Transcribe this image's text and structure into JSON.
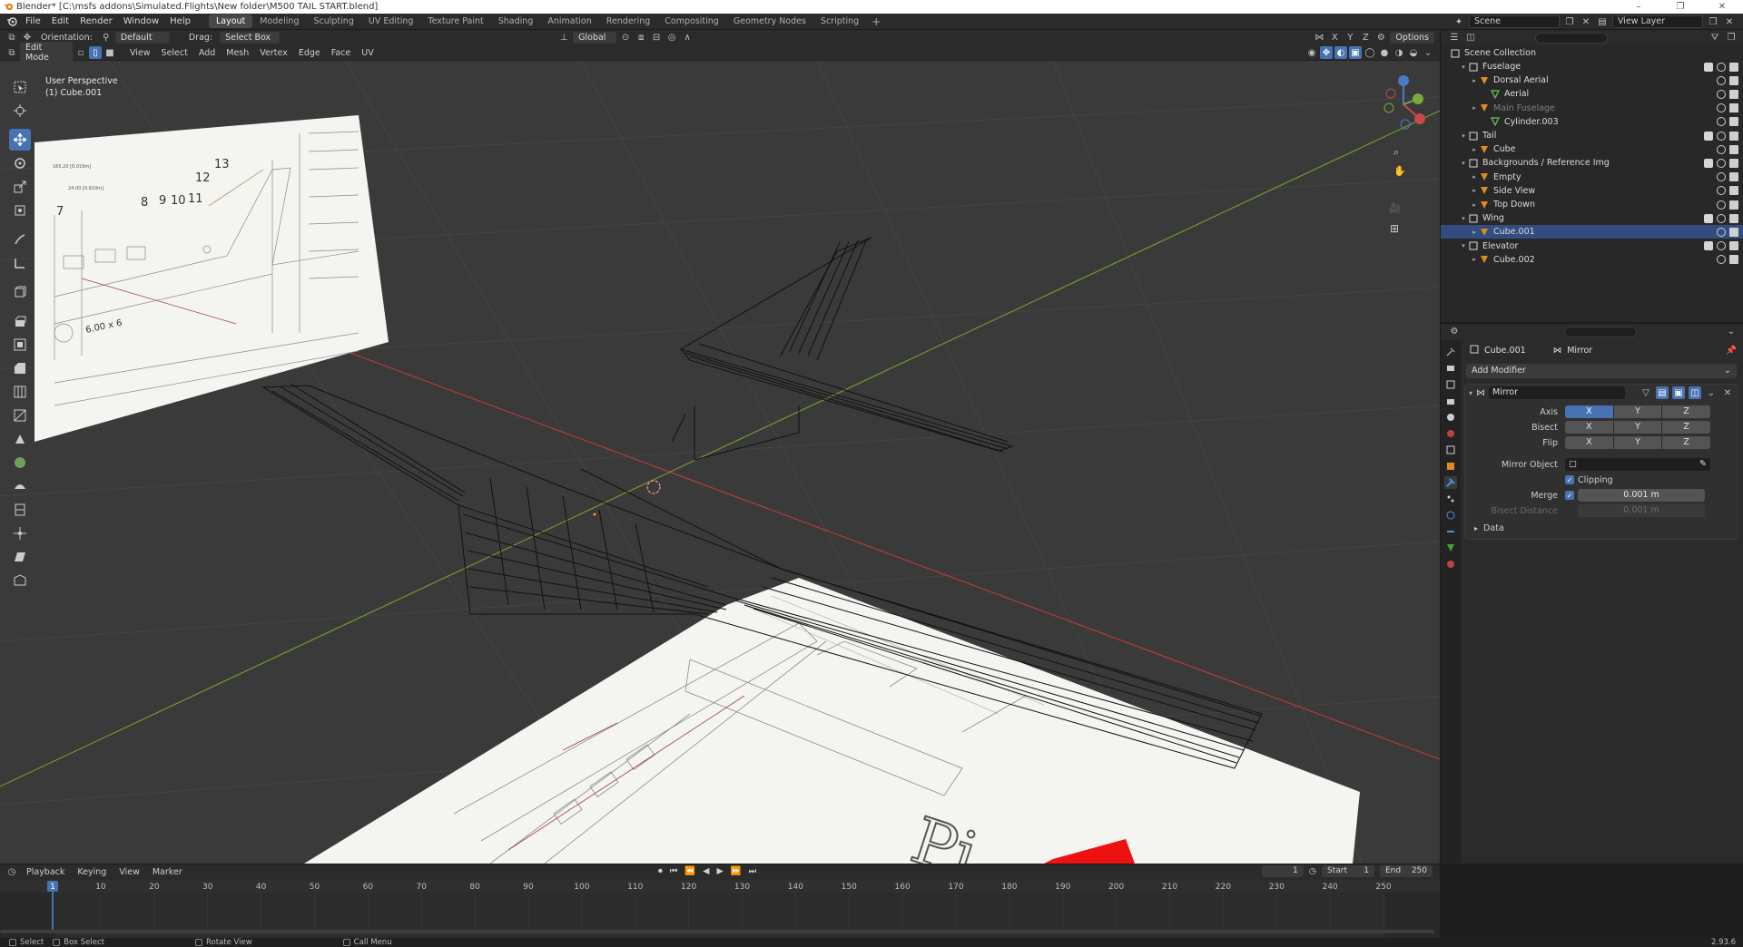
{
  "window": {
    "title": "Blender* [C:\\msfs addons\\Simulated.Flights\\New folder\\M500 TAIL START.blend]",
    "controls": [
      "–",
      "❐",
      "✕"
    ]
  },
  "menu": {
    "items": [
      "File",
      "Edit",
      "Render",
      "Window",
      "Help"
    ],
    "workspaces": [
      "Layout",
      "Modeling",
      "Sculpting",
      "UV Editing",
      "Texture Paint",
      "Shading",
      "Animation",
      "Rendering",
      "Compositing",
      "Geometry Nodes",
      "Scripting"
    ],
    "active_workspace": "Layout",
    "scene": "Scene",
    "view_layer": "View Layer"
  },
  "viewport_header": {
    "orientation_label": "Orientation:",
    "orientation_value": "Default",
    "drag_label": "Drag:",
    "drag_value": "Select Box",
    "transform_orientation": "Global",
    "options": "Options",
    "mode": "Edit Mode",
    "menus": [
      "View",
      "Select",
      "Add",
      "Mesh",
      "Vertex",
      "Edge",
      "Face",
      "UV"
    ],
    "axis_lock": [
      "X",
      "Y",
      "Z"
    ]
  },
  "viewport": {
    "perspective": "User Perspective",
    "active_object": "(1) Cube.001",
    "grid_color": "#454545",
    "x_axis_color": "#b33c3c",
    "y_axis_color": "#6f9a2f"
  },
  "blueprint": {
    "side_view_numbers": [
      "7",
      "8",
      "9",
      "10",
      "11",
      "12",
      "13"
    ],
    "side_view_dim": "6.00 x 6",
    "side_view_top_dim": "165.20 [6.019m]",
    "side_view_dim2": "24.00 [0.610m]",
    "top_view_text": "Pi"
  },
  "outliner": {
    "title": "Scene Collection",
    "rows": [
      {
        "label": "Fuselage",
        "type": "collection",
        "indent": 1
      },
      {
        "label": "Dorsal Aerial",
        "type": "object",
        "indent": 2
      },
      {
        "label": "Aerial",
        "type": "mesh",
        "indent": 3
      },
      {
        "label": "Main Fuselage",
        "type": "object",
        "indent": 2,
        "dim": true
      },
      {
        "label": "Cylinder.003",
        "type": "mesh",
        "indent": 3
      },
      {
        "label": "Tail",
        "type": "collection",
        "indent": 1
      },
      {
        "label": "Cube",
        "type": "object",
        "indent": 2
      },
      {
        "label": "Backgrounds / Reference Img",
        "type": "collection",
        "indent": 1
      },
      {
        "label": "Empty",
        "type": "empty",
        "indent": 2
      },
      {
        "label": "Side View",
        "type": "empty",
        "indent": 2
      },
      {
        "label": "Top Down",
        "type": "empty",
        "indent": 2
      },
      {
        "label": "Wing",
        "type": "collection",
        "indent": 1
      },
      {
        "label": "Cube.001",
        "type": "object",
        "indent": 2,
        "selected": true
      },
      {
        "label": "Elevator",
        "type": "collection",
        "indent": 1
      },
      {
        "label": "Cube.002",
        "type": "object",
        "indent": 2
      }
    ]
  },
  "properties": {
    "object": "Cube.001",
    "modifier_tab": "Mirror",
    "add_modifier": "Add Modifier",
    "modifier_name": "Mirror",
    "axis_label": "Axis",
    "bisect_label": "Bisect",
    "flip_label": "Flip",
    "axes": [
      "X",
      "Y",
      "Z"
    ],
    "axis_on": "X",
    "mirror_object_label": "Mirror Object",
    "clipping_label": "Clipping",
    "merge_label": "Merge",
    "merge_value": "0.001 m",
    "bisect_distance_label": "Bisect Distance",
    "bisect_distance_value": "0.001 m",
    "data_label": "Data"
  },
  "timeline": {
    "menus": [
      "Playback",
      "Keying",
      "View",
      "Marker"
    ],
    "current_frame": "1",
    "start_label": "Start",
    "start_value": "1",
    "end_label": "End",
    "end_value": "250",
    "ticks": [
      1,
      10,
      20,
      30,
      40,
      50,
      60,
      70,
      80,
      90,
      100,
      110,
      120,
      130,
      140,
      150,
      160,
      170,
      180,
      190,
      200,
      210,
      220,
      230,
      240,
      250
    ]
  },
  "statusbar": {
    "items": [
      "Select",
      "Box Select",
      "Rotate View",
      "Call Menu"
    ],
    "version": "2.93.6"
  }
}
